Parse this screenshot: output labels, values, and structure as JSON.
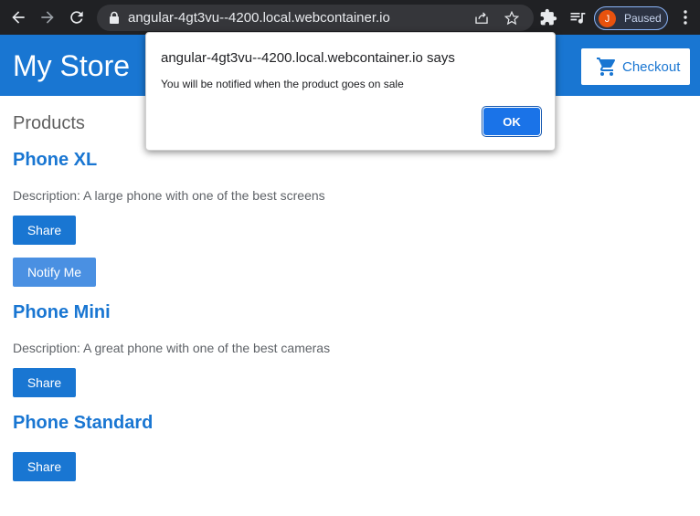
{
  "browser": {
    "url": "angular-4gt3vu--4200.local.webcontainer.io",
    "profile_initial": "J",
    "profile_status": "Paused",
    "icons": [
      "back-icon",
      "forward-icon",
      "reload-icon",
      "lock-icon",
      "share-icon",
      "star-icon",
      "extensions-icon",
      "media-icon",
      "more-icon"
    ]
  },
  "app": {
    "title": "My Store",
    "checkout_label": "Checkout",
    "products_heading": "Products",
    "products": [
      {
        "name": "Phone XL",
        "description": "Description: A large phone with one of the best screens",
        "share_label": "Share",
        "notify_label": "Notify Me"
      },
      {
        "name": "Phone Mini",
        "description": "Description: A great phone with one of the best cameras",
        "share_label": "Share"
      },
      {
        "name": "Phone Standard",
        "share_label": "Share"
      }
    ]
  },
  "dialog": {
    "origin": "angular-4gt3vu--4200.local.webcontainer.io says",
    "message": "You will be notified when the product goes on sale",
    "ok_label": "OK"
  },
  "colors": {
    "primary": "#1976d2",
    "notify_button": "#4a90e2",
    "chrome_bg": "#202124",
    "dialog_ok": "#1a73e8"
  }
}
